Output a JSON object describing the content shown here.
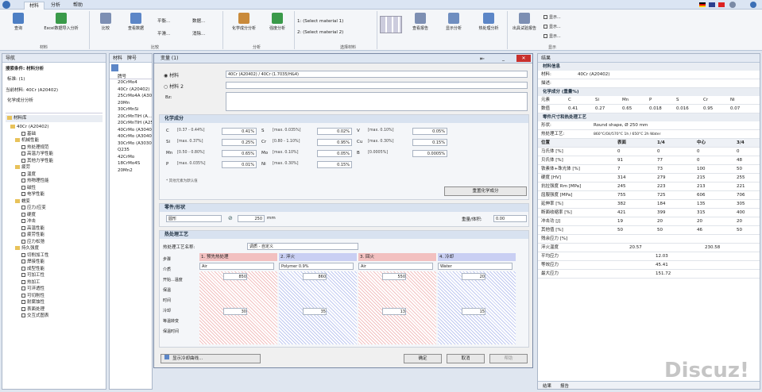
{
  "tabs": [
    "材料",
    "分析",
    "帮助"
  ],
  "ribbon": {
    "btns": [
      "查询",
      "Excel数据导入分析",
      "比较",
      "查看数据",
      "平衡...",
      "消除...",
      "平滑...",
      "数据...",
      "化学成分分析",
      "强度分析",
      "1: (Select material 1)",
      "2: (Select material 2)",
      "查看报告",
      "显示分析",
      "热处理分析",
      "出具试验报告"
    ],
    "groups": [
      "材料",
      "比较",
      "分析",
      "选择材料",
      "显示"
    ],
    "checks": [
      "显示...",
      "显示...",
      "显示..."
    ]
  },
  "nav": {
    "title": "导航",
    "filter": "搜索条件: 材料分析",
    "standard": "标准: (1)",
    "selected": "当前材料: 40Cr (A20402)",
    "analysis": "化学成分分析",
    "root": "材料库",
    "items": [
      "40Cr (A20402)",
      "基础",
      "机械性能",
      "热处理规范",
      "高温力学性能",
      "其他力学性能",
      "疲劳",
      "温度",
      "热物理性能",
      "磁性",
      "电学性能",
      "蠕变",
      "应力/应变",
      "硬度",
      "冲击",
      "高温性能",
      "疲劳性能",
      "应力松弛",
      "持久强度",
      "切削加工性",
      "焊接性能",
      "成型性能",
      "可加工性",
      "热加工",
      "可淬透性",
      "可切削性",
      "耐腐蚀性",
      "表面处理",
      "交互式图表"
    ]
  },
  "list": {
    "tabs": [
      "材料",
      "牌号"
    ],
    "header": "牌号",
    "items": [
      "20CrMo4",
      "40Cr (A20402)",
      "25CrMo4A (A30252)",
      "20Mn",
      "30CrMnSi",
      "20CrMnTiH (A...",
      "20CrMnTiH (A25...",
      "40CrMo (A30402)",
      "40CrMo (A30402)",
      "30CrMo (A30302)",
      "Q235",
      "42CrMo",
      "18CrMo4S",
      "20Mn2"
    ]
  },
  "dialog": {
    "title": "变量 (1)",
    "radio1": "材料",
    "mat1": "40Cr (A20402) / 40Cr (1.7035/H&4)",
    "radio2": "材料 2",
    "remark": "Bz:",
    "chem_title": "化学成分",
    "chem": [
      {
        "el": "C",
        "range": "[0.37 - 0.44%]",
        "val": "0.41%"
      },
      {
        "el": "Si",
        "range": "[max. 0.37%]",
        "val": "0.25%"
      },
      {
        "el": "Mn",
        "range": "[0.50 - 0.80%]",
        "val": "0.65%"
      },
      {
        "el": "P",
        "range": "[max. 0.035%]",
        "val": "0.01%"
      },
      {
        "el": "S",
        "range": "[max. 0.035%]",
        "val": "0.02%"
      },
      {
        "el": "Cr",
        "range": "[0.80 - 1.10%]",
        "val": "0.95%"
      },
      {
        "el": "Mo",
        "range": "[max. 0.10%]",
        "val": "0.05%"
      },
      {
        "el": "Ni",
        "range": "[max. 0.30%]",
        "val": "0.15%"
      },
      {
        "el": "V",
        "range": "[max. 0.10%]",
        "val": "0.05%"
      },
      {
        "el": "Cu",
        "range": "[max. 0.30%]",
        "val": "0.15%"
      },
      {
        "el": "B",
        "range": "[0.0005%]",
        "val": "0.0005%"
      }
    ],
    "chem_note": "* 其他元素为默认值",
    "reset_btn": "重置化学成分",
    "part_title": "零件/形状",
    "shape": "圆形",
    "diameter": "250",
    "unit": "mm",
    "weight_label": "重量/体积:",
    "weight": "0.00",
    "ht_title": "热处理工艺",
    "ht_label": "热处理工艺名称:",
    "ht_value": "调质 - 自定义",
    "cols": [
      "1. 预先热处理",
      "2. 淬火",
      "3. 回火",
      "4. 冷却"
    ],
    "col_media": [
      "Air",
      "Polymer 0.9%",
      "Air",
      "Water"
    ],
    "row_labels": [
      "步骤",
      "介质",
      "开始...温度",
      "保温",
      "时间",
      "冷却",
      "等温转变",
      "保温时间"
    ],
    "temps": [
      "850",
      "860",
      "550",
      "20"
    ],
    "hold": [
      "30",
      "35",
      "13",
      "15"
    ],
    "bottom_left": "显示冷却曲线...",
    "ok": "确定",
    "cancel": "取消",
    "help": "帮助"
  },
  "right": {
    "title": "结果",
    "sec1": "材料信息",
    "material_label": "材料:",
    "material": "40Cr (A20402)",
    "note_label": "描述:",
    "sec2": "化学成分 (重量%)",
    "chem_head": [
      "元素",
      "C",
      "Si",
      "Mn",
      "P",
      "S",
      "Cr",
      "Ni"
    ],
    "chem_vals": [
      "数值",
      "0.41",
      "0.27",
      "0.65",
      "0.018",
      "0.016",
      "0.95",
      "0.07"
    ],
    "sec3": "零件尺寸和热处理工艺",
    "shape_label": "形状:",
    "shape": "Round shape, Ø 250 mm",
    "process_label": "热处理工艺:",
    "process": "860°C/Oil/570°C 1h / 650°C 2h Water",
    "table_head": [
      "位置",
      "表面",
      "1/4",
      "中心",
      "3/4"
    ],
    "rows": [
      {
        "k": "马氏体 [%]",
        "v": [
          "0",
          "0",
          "0",
          "0"
        ]
      },
      {
        "k": "贝氏体 [%]",
        "v": [
          "91",
          "77",
          "0",
          "48"
        ]
      },
      {
        "k": "铁素体+珠光体 [%]",
        "v": [
          "7",
          "73",
          "100",
          "50"
        ]
      },
      {
        "k": "硬度 [HV]",
        "v": [
          "314",
          "279",
          "215",
          "255"
        ]
      },
      {
        "k": "抗拉强度 Rm [MPa]",
        "v": [
          "245",
          "223",
          "213",
          "221"
        ]
      },
      {
        "k": "屈服强度 [MPa]",
        "v": [
          "755",
          "725",
          "606",
          "706"
        ]
      },
      {
        "k": "延伸率 [%]",
        "v": [
          "382",
          "184",
          "135",
          "305"
        ]
      },
      {
        "k": "断面收缩率 [%]",
        "v": [
          "421",
          "399",
          "315",
          "400"
        ]
      },
      {
        "k": "冲击功 [J]",
        "v": [
          "19",
          "20",
          "20",
          "20"
        ]
      },
      {
        "k": "其他值 [%]",
        "v": [
          "50",
          "50",
          "46",
          "50"
        ]
      }
    ],
    "bottom_rows": [
      {
        "k": "残余应力 [%]",
        "a": "",
        "b": ""
      },
      {
        "k": "淬火温度",
        "a": "20.57",
        "b": "230.58"
      },
      {
        "k": "平均应力",
        "a": "12.03",
        "b": ""
      },
      {
        "k": "等效应力",
        "a": "45.41",
        "b": ""
      },
      {
        "k": "最大应力",
        "a": "151.72",
        "b": ""
      }
    ],
    "bottom_tabs": [
      "结果",
      "报告"
    ]
  },
  "watermark": "Discuz!"
}
